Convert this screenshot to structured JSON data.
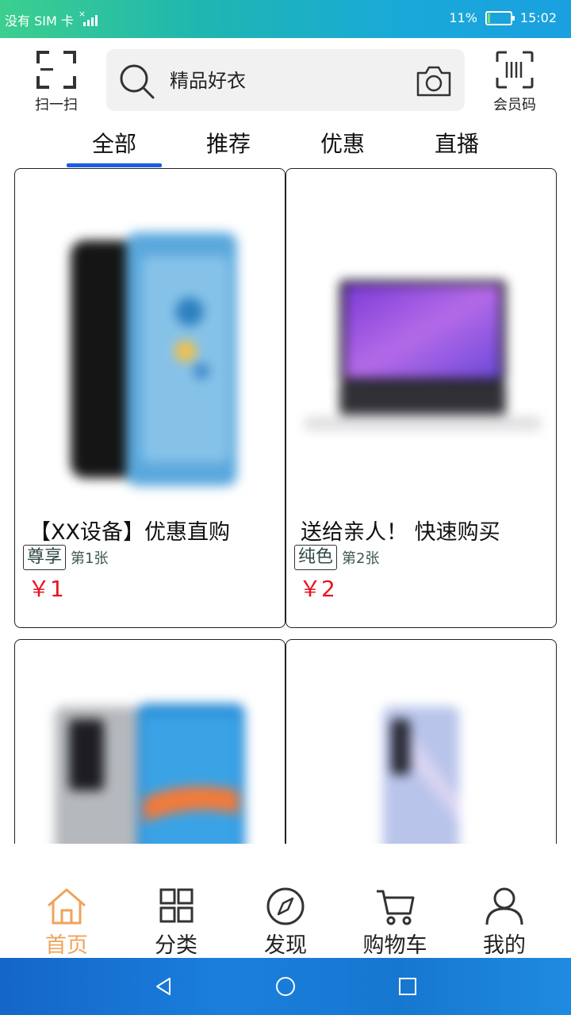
{
  "status_bar": {
    "carrier": "没有 SIM 卡",
    "battery_percent": "11%",
    "battery_level": 0.11,
    "time": "15:02"
  },
  "header": {
    "scan_label": "扫一扫",
    "search_text": "精品好衣",
    "member_label": "会员码"
  },
  "tabs": [
    {
      "label": "全部",
      "active": true
    },
    {
      "label": "推荐",
      "active": false
    },
    {
      "label": "优惠",
      "active": false
    },
    {
      "label": "直播",
      "active": false
    }
  ],
  "products": [
    {
      "title": "【XX设备】优惠直购",
      "tag": "尊享",
      "note": "第1张",
      "price": "￥1"
    },
    {
      "title": "送给亲人！ 快速购买",
      "tag": "纯色",
      "note": "第2张",
      "price": "￥2"
    },
    {
      "title": "",
      "tag": "",
      "note": "",
      "price": ""
    },
    {
      "title": "",
      "tag": "",
      "note": "",
      "price": ""
    }
  ],
  "bottom_nav": [
    {
      "label": "首页",
      "icon": "home-icon",
      "active": true
    },
    {
      "label": "分类",
      "icon": "grid-icon",
      "active": false
    },
    {
      "label": "发现",
      "icon": "compass-icon",
      "active": false
    },
    {
      "label": "购物车",
      "icon": "cart-icon",
      "active": false
    },
    {
      "label": "我的",
      "icon": "user-icon",
      "active": false
    }
  ],
  "colors": {
    "accent": "#1a5fe0",
    "price": "#e8141e",
    "nav_active": "#f0a35a"
  }
}
